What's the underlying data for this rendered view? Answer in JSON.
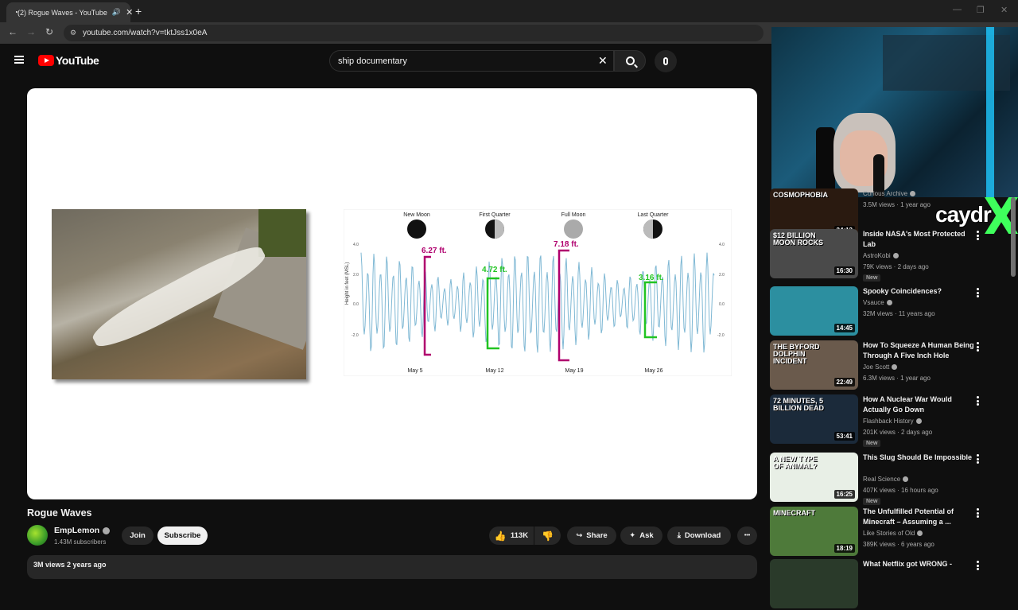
{
  "browser": {
    "tab_title": "(2) Rogue Waves - YouTube",
    "tab_close": "✕",
    "speaker_icon": "🔊",
    "new_tab": "+",
    "url": "youtube.com/watch?v=tktJss1x0eA",
    "nav_back": "←",
    "nav_forward": "→",
    "nav_reload": "↻",
    "win_min": "—",
    "win_max": "❐",
    "win_close": "✕"
  },
  "header": {
    "logo_text": "YouTube",
    "search_value": "ship documentary",
    "search_clear": "✕"
  },
  "video_slide": {
    "moon_labels": [
      "New Moon",
      "First Quarter",
      "Full Moon",
      "Last Quarter"
    ],
    "date_labels": [
      "May 5",
      "May 12",
      "May 19",
      "May 26"
    ],
    "range_labels": [
      "6.27 ft.",
      "4.72 ft.",
      "7.18 ft.",
      "3.16 ft."
    ],
    "y_axis_title": "Height in feet (MSL)",
    "y_ticks_left": [
      "4.0",
      "2.0",
      "0.0",
      "-2.0"
    ],
    "y_ticks_right": [
      "4.0",
      "2.0",
      "0.0",
      "-2.0"
    ],
    "colors": {
      "spring": "#b0006e",
      "neap": "#22c422",
      "curve": "#7fb8d4"
    }
  },
  "video": {
    "title": "Rogue Waves",
    "channel": "EmpLemon",
    "subscribers": "1.43M subscribers",
    "join": "Join",
    "subscribe": "Subscribe",
    "likes": "113K",
    "share": "Share",
    "ask": "Ask",
    "download": "Download",
    "more": "•••",
    "description": "3M views  2 years ago"
  },
  "overlay": {
    "badge_text": "caydr"
  },
  "recommendations": [
    {
      "label": "COSMOPHOBIA",
      "duration": "24:13",
      "title": "",
      "channel": "Curious Archive",
      "meta": "3.5M views · 1 year ago",
      "new": "",
      "bg": "#2a1a10"
    },
    {
      "label": "$12 BILLION MOON ROCKS",
      "duration": "16:30",
      "title": "Inside NASA's Most Protected Lab",
      "channel": "AstroKobi",
      "meta": "79K views · 2 days ago",
      "new": "New",
      "bg": "#4a4a4a"
    },
    {
      "label": "",
      "duration": "14:45",
      "title": "Spooky Coincidences?",
      "channel": "Vsauce",
      "meta": "32M views · 11 years ago",
      "new": "",
      "bg": "#2c8fa0"
    },
    {
      "label": "THE BYFORD DOLPHIN INCIDENT",
      "duration": "22:49",
      "title": "How To Squeeze A Human Being Through A Five Inch Hole",
      "channel": "Joe Scott",
      "meta": "6.3M views · 1 year ago",
      "new": "",
      "bg": "#6a5a4c"
    },
    {
      "label": "72 MINUTES, 5 BILLION DEAD",
      "duration": "53:41",
      "title": "How A Nuclear War Would Actually Go Down",
      "channel": "Flashback History",
      "meta": "201K views · 2 days ago",
      "new": "New",
      "bg": "#1b2a3a"
    },
    {
      "label": "A NEW TYPE OF ANIMAL?",
      "duration": "16:25",
      "title": "This Slug Should Be Impossible",
      "channel": "Real Science",
      "meta": "407K views · 16 hours ago",
      "new": "New",
      "bg": "#e8efe6"
    },
    {
      "label": "MINECRAFT",
      "duration": "18:19",
      "title": "The Unfulfilled Potential of Minecraft – Assuming a ...",
      "channel": "Like Stories of Old",
      "meta": "389K views · 6 years ago",
      "new": "",
      "bg": "#4e7a3a"
    },
    {
      "label": "",
      "duration": "",
      "title": "What Netflix got WRONG -",
      "channel": "",
      "meta": "",
      "new": "",
      "bg": "#2a3a2a"
    }
  ]
}
